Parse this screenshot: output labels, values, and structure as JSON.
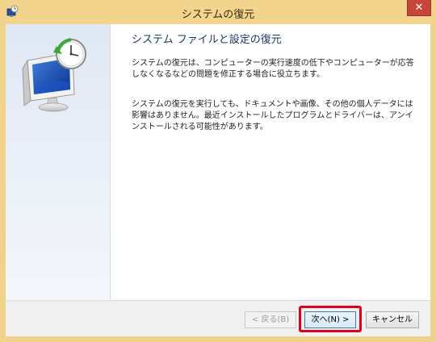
{
  "window": {
    "title": "システムの復元",
    "close_label": "✕"
  },
  "content": {
    "heading": "システム ファイルと設定の復元",
    "paragraph1": "システムの復元は、コンピューターの実行速度の低下やコンピューターが応答しなくなるなどの問題を修正する場合に役立ちます。",
    "paragraph2": "システムの復元を実行しても、ドキュメントや画像、その他の個人データには影響はありません。最近インストールしたプログラムとドライバーは、アンインストールされる可能性があります。"
  },
  "buttons": {
    "back": "< 戻る(B)",
    "next": "次へ(N) >",
    "cancel": "キャンセル"
  },
  "colors": {
    "titlebar": "#f2d48c",
    "highlight": "#e0001a",
    "heading": "#1b3a6a"
  }
}
